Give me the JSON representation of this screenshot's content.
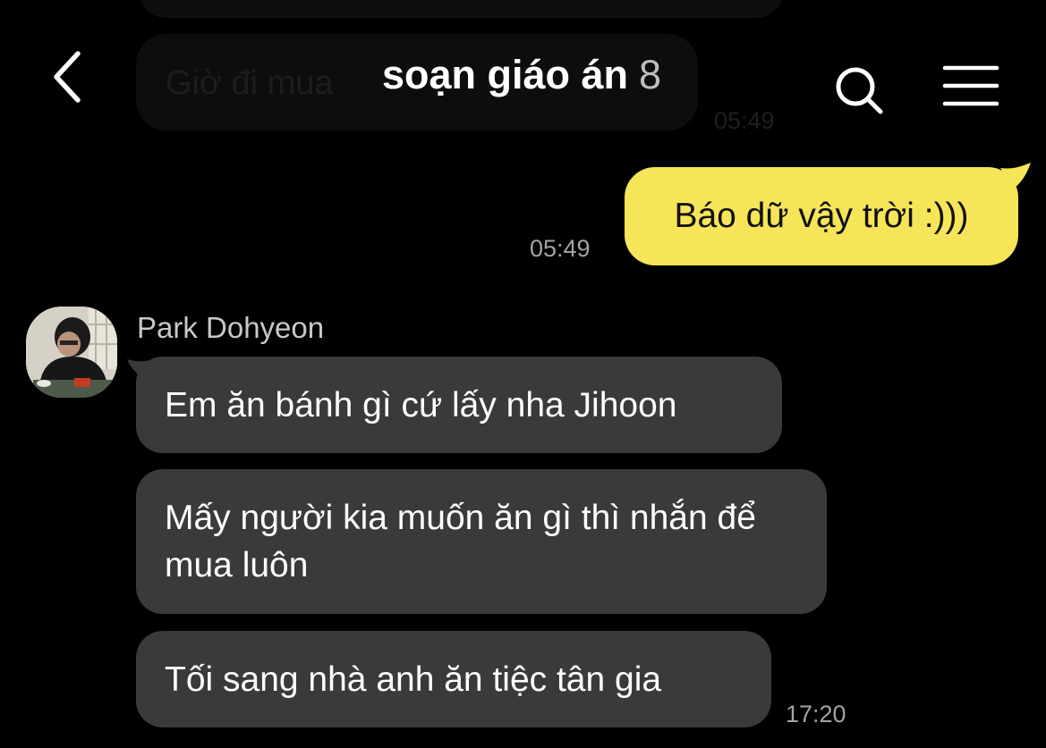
{
  "background_messages": {
    "partial_text": "Giờ đi mua",
    "time": "05:49"
  },
  "header": {
    "title": "soạn giáo án",
    "member_count": "8",
    "back_icon": "chevron-left-icon",
    "search_icon": "search-icon",
    "menu_icon": "hamburger-menu-icon"
  },
  "messages": {
    "outgoing": [
      {
        "text": "Báo dữ vậy trời :)))",
        "time": "05:49"
      }
    ],
    "incoming": {
      "sender": "Park Dohyeon",
      "items": [
        {
          "text": "Em ăn bánh gì cứ lấy nha Jihoon"
        },
        {
          "text": "Mấy người kia muốn ăn gì thì nhắn để mua luôn"
        },
        {
          "text": "Tối sang nhà anh ăn tiệc tân gia",
          "time": "17:20"
        }
      ]
    }
  },
  "colors": {
    "background": "#000000",
    "outgoing_bubble": "#f7e559",
    "incoming_bubble": "#3a3a3c",
    "timestamp": "#a3a3a3"
  }
}
